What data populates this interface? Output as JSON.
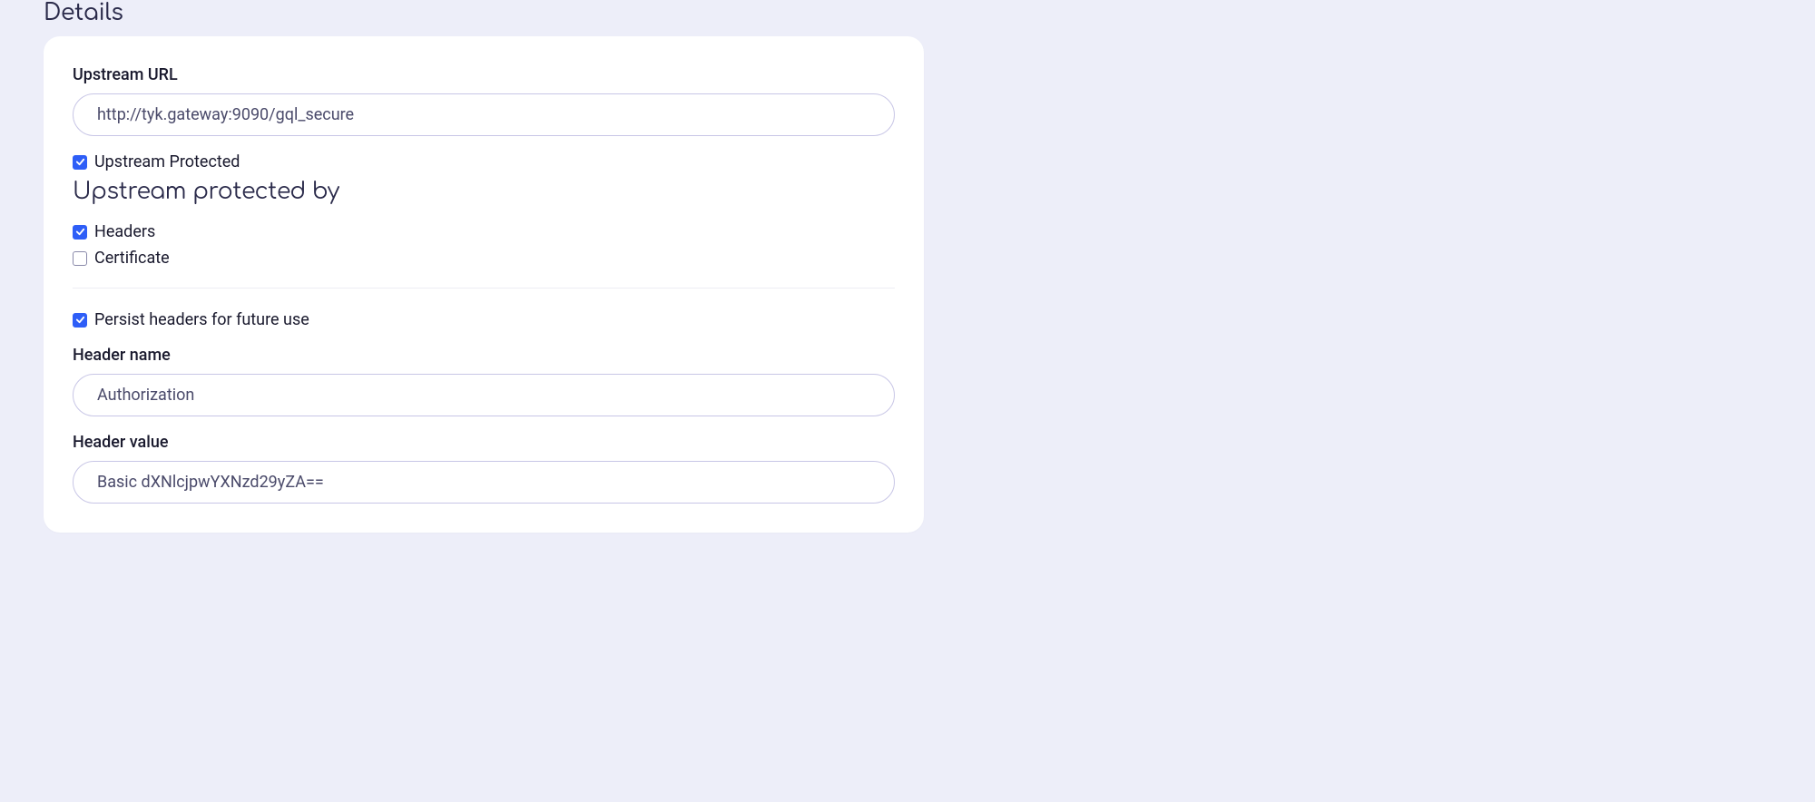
{
  "section": {
    "title": "Details"
  },
  "upstream_url": {
    "label": "Upstream URL",
    "value": "http://tyk.gateway:9090/gql_secure"
  },
  "upstream_protected": {
    "checked": true,
    "label": "Upstream Protected"
  },
  "protected_by": {
    "title": "Upstream protected by",
    "headers": {
      "checked": true,
      "label": "Headers"
    },
    "certificate": {
      "checked": false,
      "label": "Certificate"
    }
  },
  "persist_headers": {
    "checked": true,
    "label": "Persist headers for future use"
  },
  "header_name": {
    "label": "Header name",
    "value": "Authorization"
  },
  "header_value": {
    "label": "Header value",
    "value": "Basic dXNlcjpwYXNzd29yZA=="
  }
}
